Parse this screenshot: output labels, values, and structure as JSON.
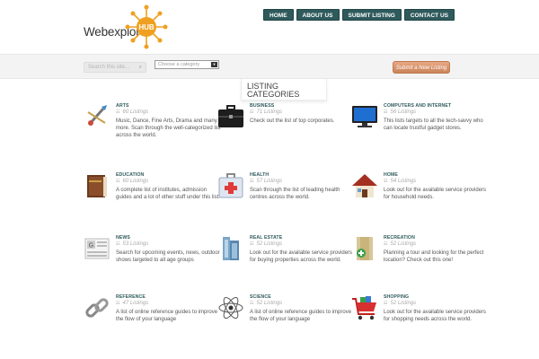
{
  "header": {
    "logo_text": "Webexplorer",
    "logo_badge": "HUB",
    "nav": [
      "HOME",
      "ABOUT US",
      "SUBMIT LISTING",
      "CONTACT US"
    ]
  },
  "toolbar": {
    "search_placeholder": "Search this site...",
    "category_select": "Choose a category",
    "submit_label": "Submit a New Listing"
  },
  "section_title": {
    "line1": "LISTING",
    "line2": "CATEGORIES"
  },
  "categories": [
    {
      "name": "ARTS",
      "count": "60 Listings",
      "desc": "Music, Dance, Fine Arts, Drama and many more. Scan through the well-categorized list across the world.",
      "icon": "art-tools-icon"
    },
    {
      "name": "BUSINESS",
      "count": "71 Listings",
      "desc": "Check out the list of top corporates.",
      "icon": "briefcase-icon"
    },
    {
      "name": "COMPUTERS AND INTERNET",
      "count": "56 Listings",
      "desc": "This lists targets to all the tech-savvy who can locate trustful gadget stores.",
      "icon": "monitor-icon"
    },
    {
      "name": "EDUCATION",
      "count": "60 Listings",
      "desc": "A complete list of institutes, admission guides and a lot of other stuff under this list.",
      "icon": "books-icon"
    },
    {
      "name": "HEALTH",
      "count": "57 Listings",
      "desc": "Scan through the list of leading health centres across the world.",
      "icon": "first-aid-icon"
    },
    {
      "name": "HOME",
      "count": "54 Listings",
      "desc": "Look out for the available service providers for household needs.",
      "icon": "house-icon"
    },
    {
      "name": "NEWS",
      "count": "53 Listings",
      "desc": "Search for upcoming events, news, outdoor shows targeted to all age groups",
      "icon": "newspaper-icon"
    },
    {
      "name": "REAL ESTATE",
      "count": "52 Listings",
      "desc": "Look out for the available service providers for buying properties across the world.",
      "icon": "buildings-icon"
    },
    {
      "name": "RECREATION",
      "count": "52 Listings",
      "desc": "Planning a tour and looking for the perfect location? Check out this one!",
      "icon": "map-icon"
    },
    {
      "name": "REFERENCE",
      "count": "47 Listings",
      "desc": "A list of online reference guides to improve the flow of your language",
      "icon": "chain-link-icon"
    },
    {
      "name": "SCIENCE",
      "count": "52 Listings",
      "desc": "A list of online reference guides to improve the flow of your language",
      "icon": "atom-icon"
    },
    {
      "name": "SHOPPING",
      "count": "52 Listings",
      "desc": "Look out for the available service providers for shopping needs across the world.",
      "icon": "shopping-cart-icon"
    }
  ],
  "colors": {
    "nav_bg": "#2f5a5c",
    "accent": "#c98459",
    "logo_orange": "#f0a020"
  }
}
